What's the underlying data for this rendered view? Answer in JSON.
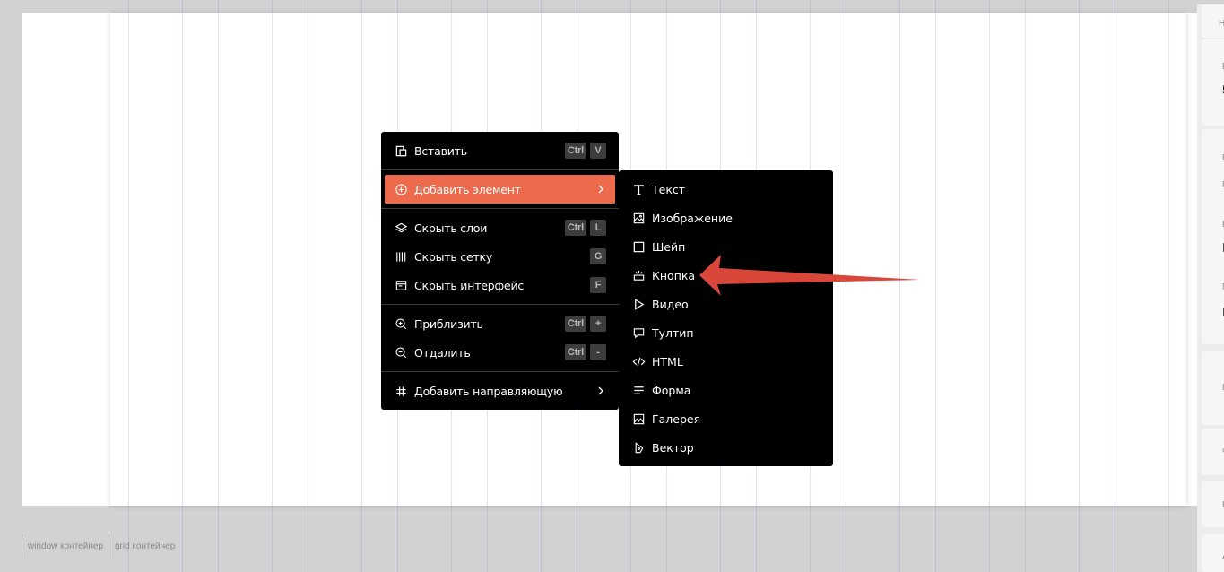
{
  "main_menu": {
    "items": [
      {
        "label": "Вставить",
        "icon": "paste-icon",
        "keys": [
          "Ctrl",
          "V"
        ]
      },
      {
        "label": "Добавить элемент",
        "icon": "add-circle-icon",
        "submenu": true,
        "active": true
      },
      {
        "label": "Скрыть слои",
        "icon": "layers-icon",
        "keys": [
          "Ctrl",
          "L"
        ]
      },
      {
        "label": "Скрыть сетку",
        "icon": "grid-columns-icon",
        "keys": [
          "G"
        ]
      },
      {
        "label": "Скрыть интерфейс",
        "icon": "interface-icon",
        "keys": [
          "F"
        ]
      },
      {
        "label": "Приблизить",
        "icon": "zoom-in-icon",
        "keys": [
          "Ctrl",
          "+"
        ]
      },
      {
        "label": "Отдалить",
        "icon": "zoom-out-icon",
        "keys": [
          "Ctrl",
          "-"
        ]
      },
      {
        "label": "Добавить направляющую",
        "icon": "hash-icon",
        "submenu": true
      }
    ]
  },
  "submenu": {
    "items": [
      {
        "label": "Текст",
        "icon": "text-icon"
      },
      {
        "label": "Изображение",
        "icon": "image-icon"
      },
      {
        "label": "Шейп",
        "icon": "shape-icon"
      },
      {
        "label": "Кнопка",
        "icon": "button-icon"
      },
      {
        "label": "Видео",
        "icon": "play-icon"
      },
      {
        "label": "Тултип",
        "icon": "tooltip-icon"
      },
      {
        "label": "HTML",
        "icon": "code-icon"
      },
      {
        "label": "Форма",
        "icon": "form-icon"
      },
      {
        "label": "Галерея",
        "icon": "gallery-icon"
      },
      {
        "label": "Вектор",
        "icon": "vector-icon"
      }
    ]
  },
  "breadcrumb": [
    "window контейнер",
    "grid контейнер"
  ],
  "side_panel": {
    "texts": [
      "НА",
      "ВЫ",
      "5",
      "В",
      "П",
      "В",
      "L",
      "М",
      "Н",
      "Ц",
      "Ф",
      "Р",
      "А"
    ]
  },
  "colors": {
    "accent": "#ee6a4c",
    "menu_bg": "#000000",
    "arrow": "#d9473a"
  }
}
